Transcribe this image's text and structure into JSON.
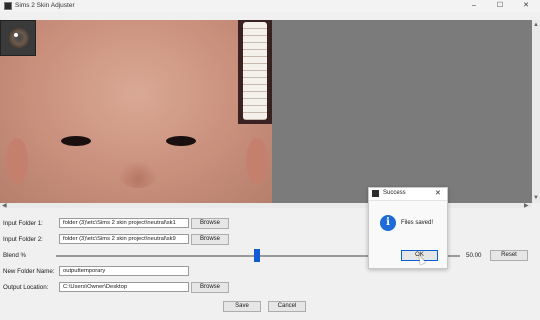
{
  "window": {
    "title": "Sims 2 Skin Adjuster",
    "minimize": "–",
    "maximize": "☐",
    "close": "✕"
  },
  "scroll": {
    "up": "▲",
    "down": "▼",
    "left": "◀",
    "right": "▶"
  },
  "form": {
    "input_folder_1": {
      "label": "Input Folder 1:",
      "value": "folder (3)\\etc\\Sims 2 skin project\\neutral\\sk1",
      "browse": "Browse"
    },
    "input_folder_2": {
      "label": "Input Folder 2:",
      "value": "folder (3)\\etc\\Sims 2 skin project\\neutral\\sk9",
      "browse": "Browse"
    },
    "blend": {
      "label": "Blend %",
      "value": 50,
      "value_text": "50.00",
      "reset": "Reset"
    },
    "new_folder": {
      "label": "New Folder Name:",
      "value": "outputtemporary"
    },
    "output": {
      "label": "Output Location:",
      "value": "C:\\Users\\Owner\\Desktop",
      "browse": "Browse"
    },
    "save": "Save",
    "cancel": "Cancel"
  },
  "dialog": {
    "title": "Success",
    "close": "✕",
    "icon": "i",
    "message": "Files saved!",
    "ok": "OK"
  }
}
